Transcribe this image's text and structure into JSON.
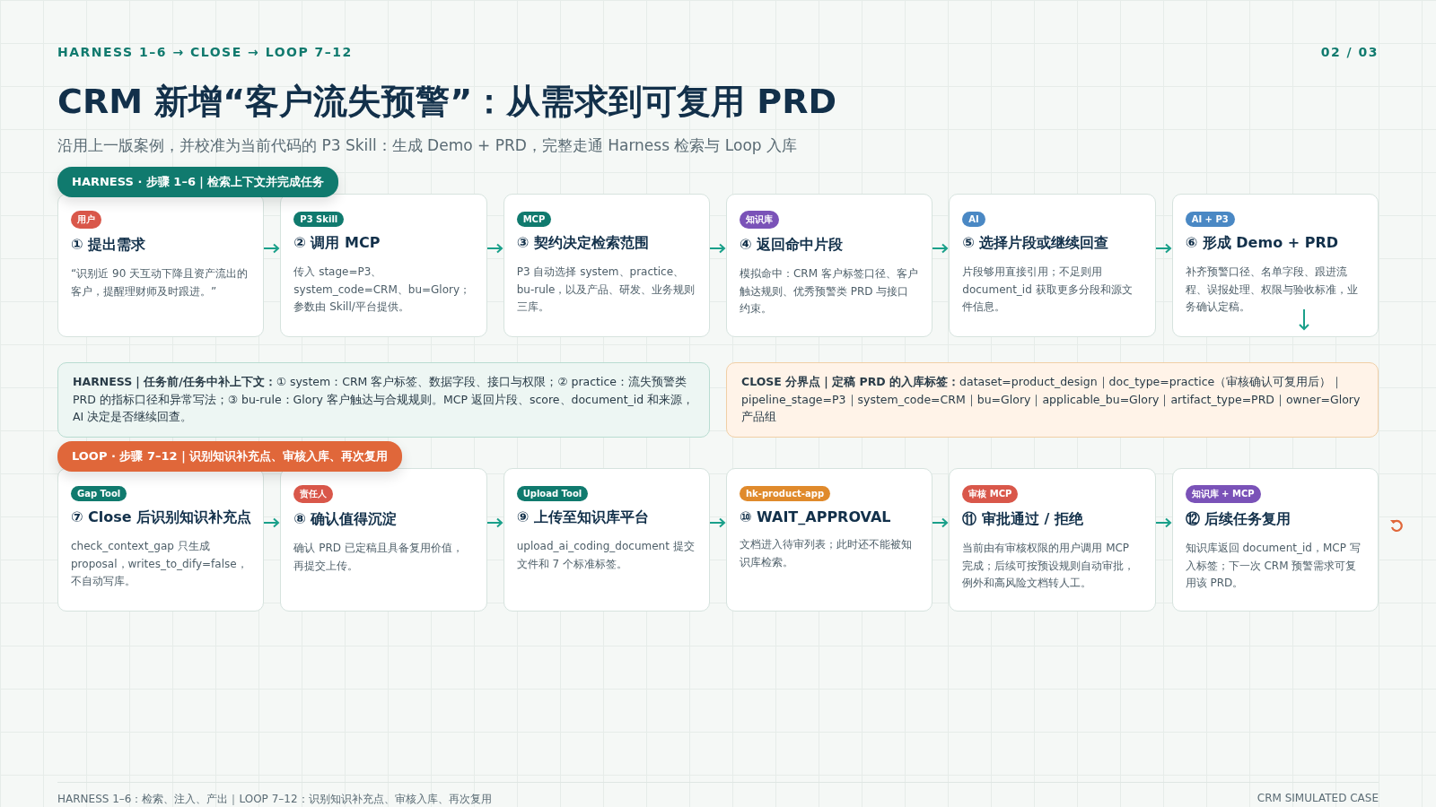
{
  "header": {
    "kicker": "HARNESS 1–6 → CLOSE → LOOP 7–12",
    "page": "02 / 03"
  },
  "title": "CRM 新增“客户流失预警”：从需求到可复用 PRD",
  "subtitle": "沿用上一版案例，并校准为当前代码的 P3 Skill：生成 Demo + PRD，完整走通 Harness 检索与 Loop 入库",
  "harness": {
    "label": "HARNESS · 步骤 1–6｜检索上下文并完成任务",
    "steps": [
      {
        "tag": "用户",
        "color": "#d9574a",
        "title": "① 提出需求",
        "body": "“识别近 90 天互动下降且资产流出的客户，提醒理财师及时跟进。”"
      },
      {
        "tag": "P3 Skill",
        "color": "#107a6e",
        "title": "② 调用 MCP",
        "body": "传入 stage=P3、system_code=CRM、bu=Glory；参数由 Skill/平台提供。"
      },
      {
        "tag": "MCP",
        "color": "#107a6e",
        "title": "③ 契约决定检索范围",
        "body": "P3 自动选择 system、practice、bu-rule，以及产品、研发、业务规则三库。"
      },
      {
        "tag": "知识库",
        "color": "#7a52b8",
        "title": "④ 返回命中片段",
        "body": "模拟命中：CRM 客户标签口径、客户触达规则、优秀预警类 PRD 与接口约束。"
      },
      {
        "tag": "AI",
        "color": "#4a88c4",
        "title": "⑤ 选择片段或继续回查",
        "body": "片段够用直接引用；不足则用 document_id 获取更多分段和源文件信息。"
      },
      {
        "tag": "AI + P3",
        "color": "#4a88c4",
        "title": "⑥ 形成 Demo + PRD",
        "body": "补齐预警口径、名单字段、跟进流程、误报处理、权限与验收标准，业务确认定稿。"
      }
    ]
  },
  "notes": [
    {
      "kind": "harness",
      "text": "**HARNESS｜任务前/任务中补上下文：**① system：CRM 客户标签、数据字段、接口与权限；② practice：流失预警类 PRD 的指标口径和异常写法；③ bu-rule：Glory 客户触达与合规规则。MCP 返回片段、score、document_id 和来源，AI 决定是否继续回查。"
    },
    {
      "kind": "close",
      "text": "**CLOSE 分界点｜定稿 PRD 的入库标签：**dataset=product_design｜doc_type=practice（审核确认可复用后）｜pipeline_stage=P3｜system_code=CRM｜bu=Glory｜applicable_bu=Glory｜artifact_type=PRD｜owner=Glory产品组"
    }
  ],
  "loop": {
    "label": "LOOP · 步骤 7–12｜识别知识补充点、审核入库、再次复用",
    "steps": [
      {
        "tag": "Gap Tool",
        "color": "#107a6e",
        "title": "⑦ Close 后识别知识补充点",
        "body": "check_context_gap 只生成 proposal，writes_to_dify=false，不自动写库。"
      },
      {
        "tag": "责任人",
        "color": "#d9574a",
        "title": "⑧ 确认值得沉淀",
        "body": "确认 PRD 已定稿且具备复用价值，再提交上传。"
      },
      {
        "tag": "Upload Tool",
        "color": "#107a6e",
        "title": "⑨ 上传至知识库平台",
        "body": "upload_ai_coding_document 提交文件和 7 个标准标签。"
      },
      {
        "tag": "hk-product-app",
        "color": "#e08a2c",
        "title": "⑩ WAIT_APPROVAL",
        "body": "文档进入待审列表；此时还不能被知识库检索。"
      },
      {
        "tag": "审核 MCP",
        "color": "#d9574a",
        "title": "⑪ 审批通过 / 拒绝",
        "body": "当前由有审核权限的用户调用 MCP 完成；后续可按预设规则自动审批，例外和高风险文档转人工。"
      },
      {
        "tag": "知识库 + MCP",
        "color": "#7a52b8",
        "title": "⑫ 后续任务复用",
        "body": "知识库返回 document_id，MCP 写入标签；下一次 CRM 预警需求可复用该 PRD。"
      }
    ]
  },
  "footer": {
    "left": "HARNESS 1–6：检索、注入、产出｜LOOP 7–12：识别知识补充点、审核入库、再次复用",
    "right": "CRM SIMULATED CASE"
  }
}
